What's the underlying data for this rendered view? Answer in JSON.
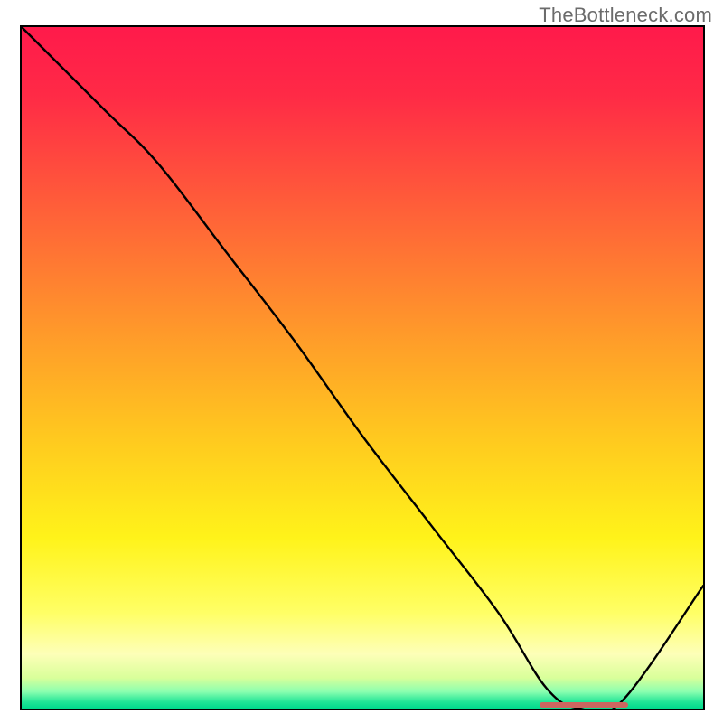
{
  "watermark": "TheBottleneck.com",
  "chart_data": {
    "type": "line",
    "title": "",
    "xlabel": "",
    "ylabel": "",
    "xlim": [
      0,
      100
    ],
    "ylim": [
      0,
      100
    ],
    "series": [
      {
        "name": "bottleneck-curve",
        "x": [
          0,
          12,
          20,
          30,
          40,
          50,
          60,
          70,
          77,
          82,
          88,
          100
        ],
        "values": [
          100,
          88,
          80,
          67,
          54,
          40,
          27,
          14,
          3,
          0,
          1,
          18
        ]
      }
    ],
    "optimal_range": {
      "start": 76,
      "end": 89,
      "y": 0.6
    },
    "gradient_stops": [
      {
        "offset": 0.0,
        "color": "#ff1a4b"
      },
      {
        "offset": 0.1,
        "color": "#ff2a46"
      },
      {
        "offset": 0.25,
        "color": "#ff5a3a"
      },
      {
        "offset": 0.45,
        "color": "#ff9a2a"
      },
      {
        "offset": 0.6,
        "color": "#ffc81f"
      },
      {
        "offset": 0.75,
        "color": "#fff31a"
      },
      {
        "offset": 0.86,
        "color": "#ffff66"
      },
      {
        "offset": 0.92,
        "color": "#fdffb8"
      },
      {
        "offset": 0.955,
        "color": "#d9ff9a"
      },
      {
        "offset": 0.975,
        "color": "#8cffb0"
      },
      {
        "offset": 0.99,
        "color": "#22e597"
      },
      {
        "offset": 1.0,
        "color": "#00d98c"
      }
    ],
    "marker_color": "#cc6660"
  }
}
